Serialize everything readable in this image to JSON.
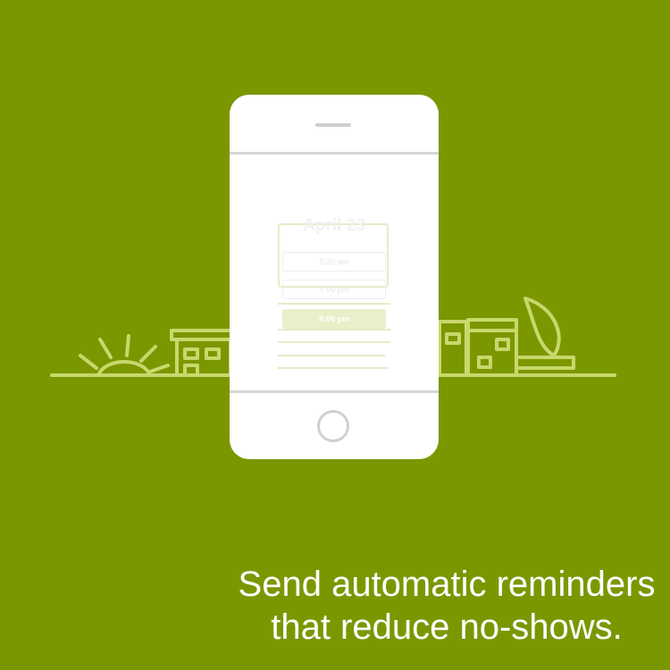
{
  "colors": {
    "background": "#7b9700",
    "phone": "#ffffff",
    "line_art": "#c8d86b",
    "slot_highlight": "#e8efc9"
  },
  "phone": {
    "calendar": {
      "title": "April 23",
      "slots": [
        "5:30 pm",
        "7:00 pm",
        "8:00 pm"
      ],
      "selected_slot": "8:00 pm"
    },
    "icons": {
      "speaker": "speaker-icon",
      "home": "home-button-icon"
    }
  },
  "illustration": {
    "left": "sunrise-icon",
    "center_left": "building-icon",
    "center_right": "building-icon",
    "right": "moon-icon"
  },
  "headline": {
    "line1": "Send automatic reminders",
    "line2": "that reduce no-shows."
  }
}
